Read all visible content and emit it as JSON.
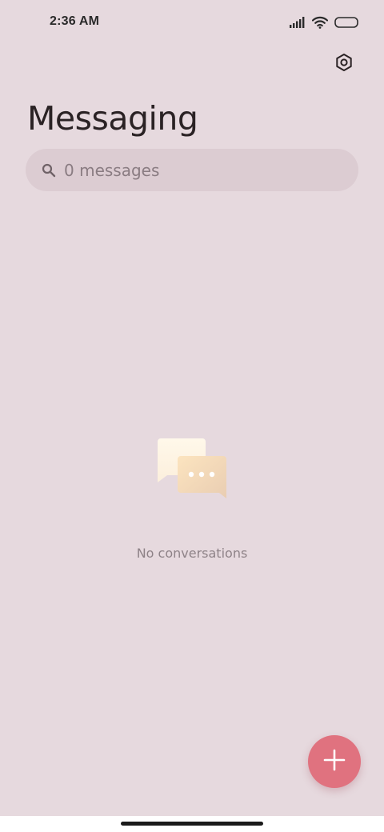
{
  "status_bar": {
    "time": "2:36 AM",
    "icons": [
      "signal-icon",
      "wifi-icon",
      "battery-icon"
    ]
  },
  "header": {
    "title": "Messaging",
    "settings_icon": "settings-icon"
  },
  "search": {
    "placeholder": "0 messages",
    "icon": "search-icon"
  },
  "empty_state": {
    "illustration": "chat-bubbles-icon",
    "text": "No conversations"
  },
  "fab": {
    "icon": "plus-icon",
    "color": "#e0727f"
  },
  "colors": {
    "background": "#e6d9de",
    "search_background": "#dcccd2",
    "accent": "#e0727f"
  }
}
